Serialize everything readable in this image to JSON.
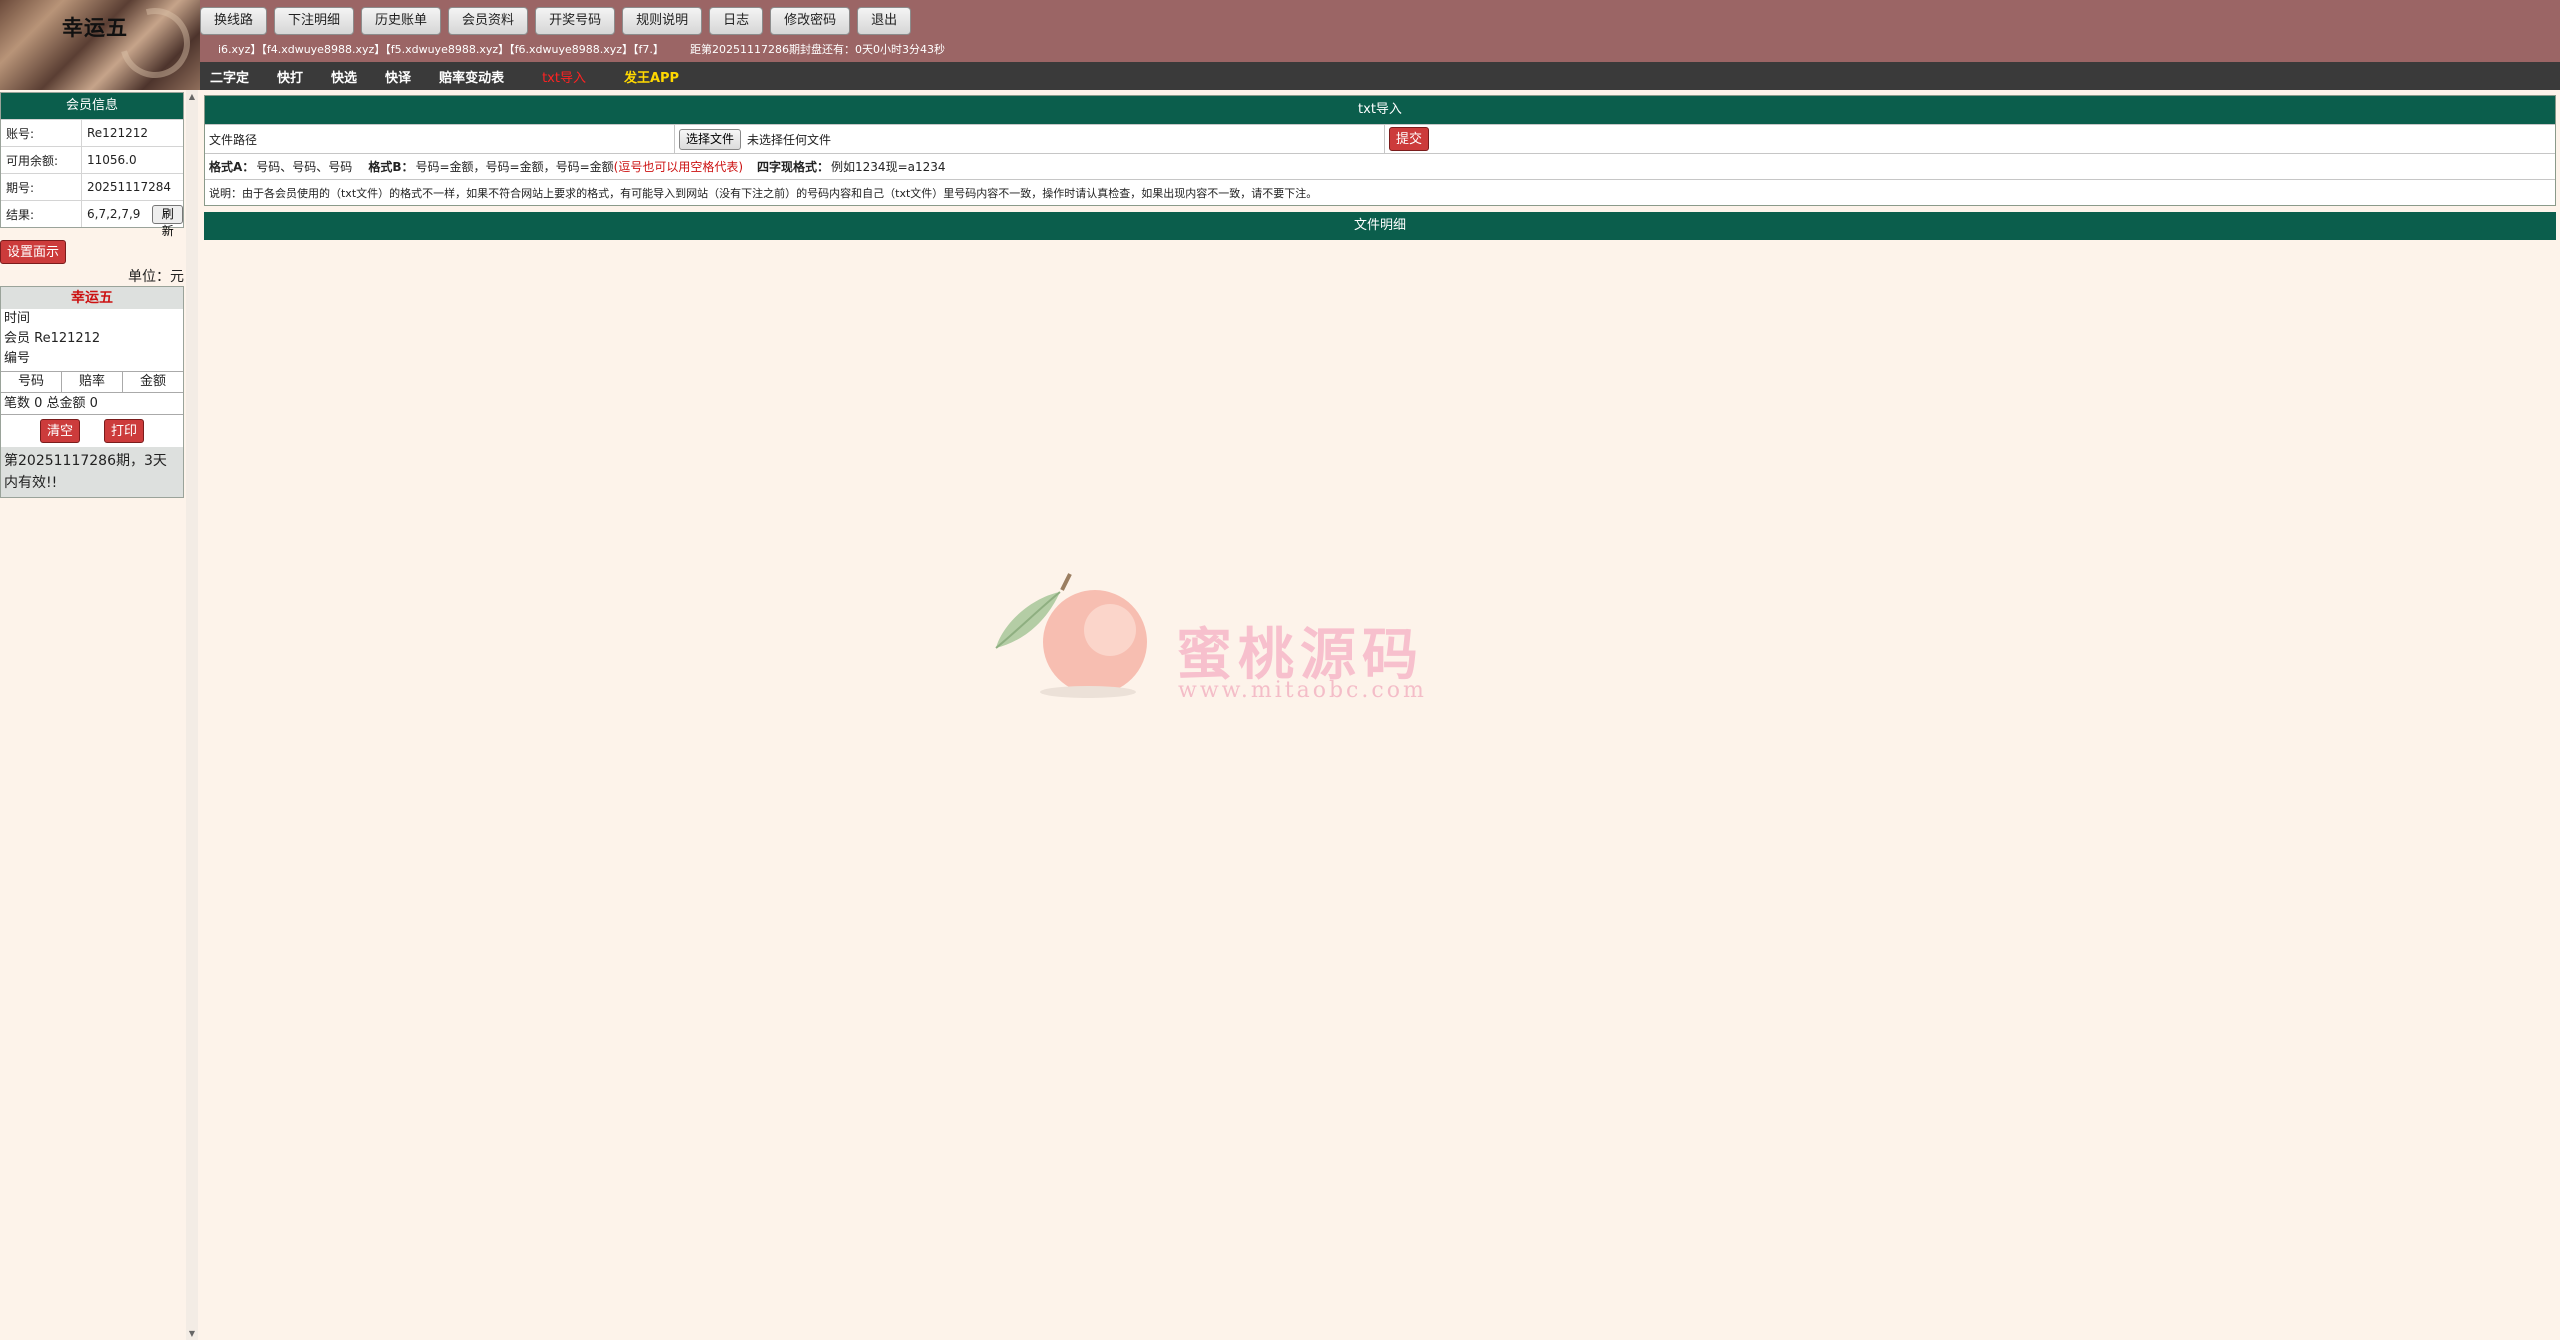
{
  "header": {
    "title": "幸运五",
    "buttons": [
      "换线路",
      "下注明细",
      "历史账单",
      "会员资料",
      "开奖号码",
      "规则说明",
      "日志",
      "修改密码",
      "退出"
    ],
    "line_links": "i6.xyz】【f4.xdwuye8988.xyz】【f5.xdwuye8988.xyz】【f6.xdwuye8988.xyz】【f7.】",
    "countdown": "距第20251117286期封盘还有：0天0小时3分43秒"
  },
  "nav": {
    "items": [
      "二字定",
      "快打",
      "快选",
      "快译",
      "赔率变动表"
    ],
    "active": "txt导入",
    "app": "发王APP"
  },
  "member": {
    "head": "会员信息",
    "rows": [
      {
        "k": "账号:",
        "v": "Re121212"
      },
      {
        "k": "可用余额:",
        "v": "11056.0"
      },
      {
        "k": "期号:",
        "v": "20251117284"
      },
      {
        "k": "结果:",
        "v": "6,7,2,7,9"
      }
    ],
    "refresh": "刷新"
  },
  "settings_button": "设置面示",
  "unit": "单位：元",
  "slip": {
    "title": "幸运五",
    "time": "时间",
    "member": "会员 Re121212",
    "number": "编号",
    "columns": [
      "号码",
      "赔率",
      "金额"
    ],
    "total": "笔数 0 总金额 0",
    "clear": "清空",
    "print": "打印",
    "note": "第20251117286期，3天内有效!!"
  },
  "import": {
    "head": "txt导入",
    "file_label": "文件路径",
    "choose": "选择文件",
    "no_file": "未选择任何文件",
    "submit": "提交",
    "format_a_label": "格式A：",
    "format_a": "号码、号码、号码",
    "format_b_label": "格式B：",
    "format_b": "号码=金额，号码=金额，号码=金额",
    "format_b_note": "(逗号也可以用空格代表)",
    "four_label": "四字现格式：",
    "four": "例如1234现=a1234",
    "note": "说明：由于各会员使用的（txt文件）的格式不一样，如果不符合网站上要求的格式，有可能导入到网站（没有下注之前）的号码内容和自己（txt文件）里号码内容不一致，操作时请认真检查，如果出现内容不一致，请不要下注。"
  },
  "detail": {
    "head": "文件明细"
  },
  "watermark": {
    "text": "蜜桃源码",
    "url": "www.mitaobc.com"
  },
  "colors": {
    "header": "#9b6565",
    "nav": "#3a3a3a",
    "green": "#0b5e4c",
    "red_button": "#cc3b3b",
    "background": "#fdf3ea"
  }
}
